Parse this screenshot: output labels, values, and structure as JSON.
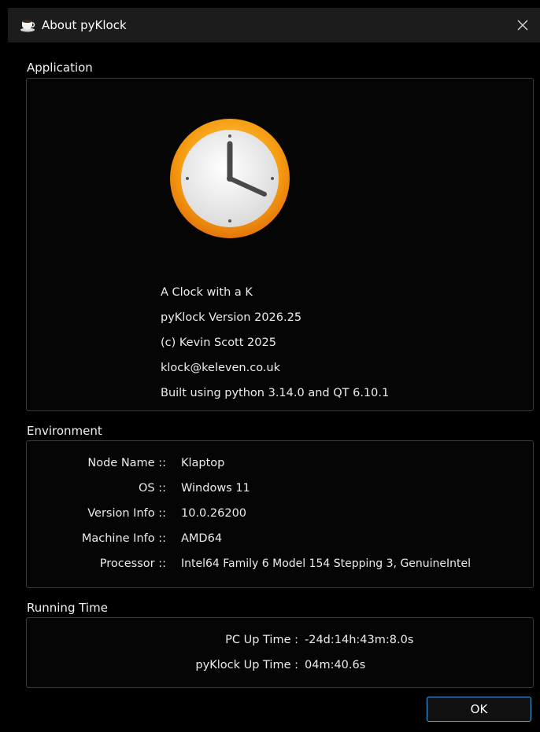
{
  "window": {
    "title": "About pyKlock",
    "app_icon": "coffee-cup-icon",
    "close_icon": "close-icon"
  },
  "application": {
    "heading": "Application",
    "logo_icon": "clock-icon",
    "lines": [
      "A Clock with a K",
      "pyKlock  Version 2026.25",
      "(c) Kevin Scott 2025",
      "klock@keleven.co.uk",
      "Built using python 3.14.0 and QT 6.10.1"
    ]
  },
  "environment": {
    "heading": "Environment",
    "rows": [
      {
        "key": "Node Name ::",
        "value": "Klaptop"
      },
      {
        "key": "OS ::",
        "value": "Windows  11"
      },
      {
        "key": "Version Info ::",
        "value": "10.0.26200"
      },
      {
        "key": "Machine Info ::",
        "value": "AMD64"
      },
      {
        "key": "Processor ::",
        "value": "Intel64 Family 6 Model 154 Stepping 3, GenuineIntel"
      }
    ]
  },
  "running_time": {
    "heading": "Running Time",
    "rows": [
      {
        "key": "PC Up Time :",
        "value": "-24d:14h:43m:8.0s"
      },
      {
        "key": "pyKlock Up Time :",
        "value": "04m:40.6s"
      }
    ]
  },
  "buttons": {
    "ok_label": "OK"
  },
  "colors": {
    "background": "#000000",
    "titlebar": "#1c1c1c",
    "clock_orange": "#f39a12",
    "button_border": "#4aa3df"
  }
}
